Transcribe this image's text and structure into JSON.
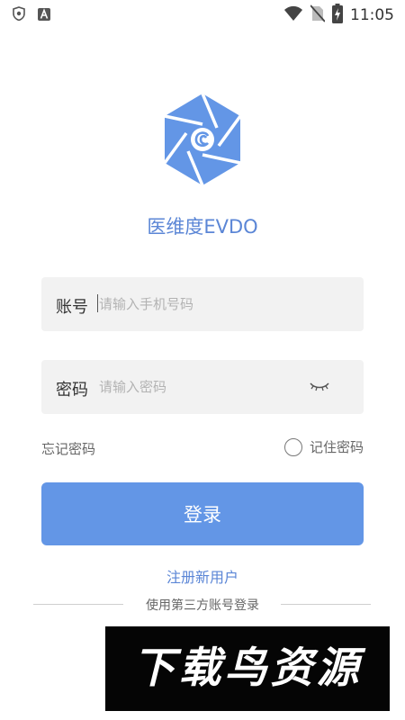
{
  "status_bar": {
    "time": "11:05",
    "left_icons": [
      "shield-icon",
      "a-letter-icon"
    ],
    "right_icons": [
      "wifi-icon",
      "no-sim-icon",
      "battery-charging-icon"
    ]
  },
  "app": {
    "name": "医维度EVDO",
    "logo": "camera-aperture-logo",
    "brand_color": "#6396e6"
  },
  "form": {
    "account": {
      "label": "账号",
      "placeholder": "请输入手机号码",
      "value": ""
    },
    "password": {
      "label": "密码",
      "placeholder": "请输入密码",
      "value": "",
      "toggle_icon": "eye-closed-icon"
    },
    "forgot_password": "忘记密码",
    "remember_password": {
      "label": "记住密码",
      "checked": false
    },
    "login_button": "登录"
  },
  "register_link": "注册新用户",
  "third_party_login": "使用第三方账号登录",
  "watermark": "下载鸟资源"
}
